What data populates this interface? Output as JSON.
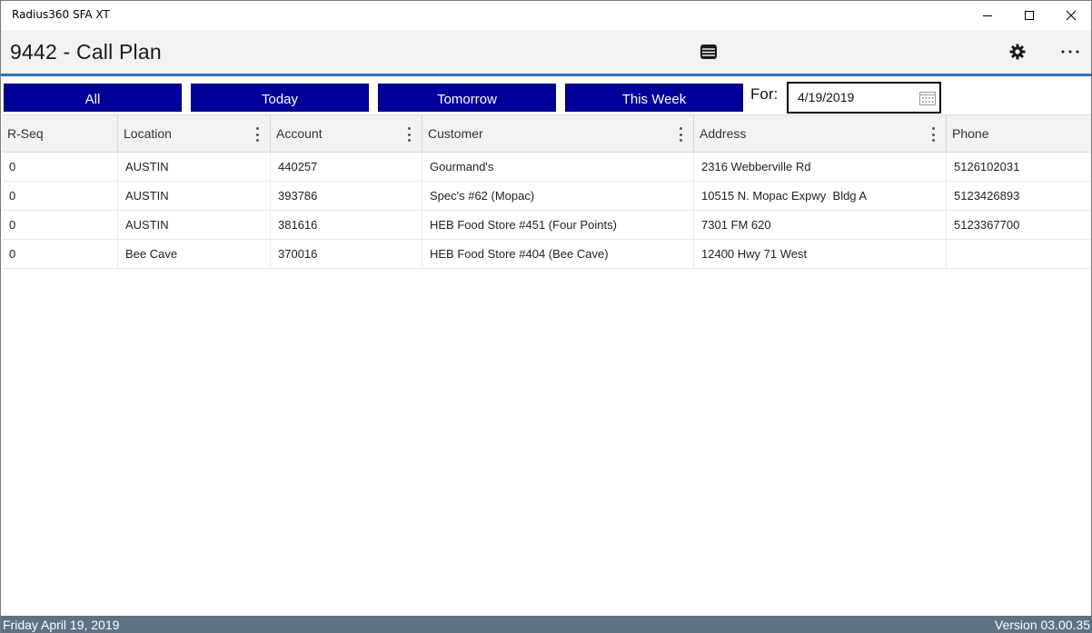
{
  "window": {
    "app_title": "Radius360 SFA XT"
  },
  "header": {
    "title": "9442 - Call Plan"
  },
  "filters": {
    "all_label": "All",
    "today_label": "Today",
    "tomorrow_label": "Tomorrow",
    "this_week_label": "This Week",
    "for_label": "For:",
    "date_value": "4/19/2019"
  },
  "grid": {
    "columns": [
      "R-Seq",
      "Location",
      "Account",
      "Customer",
      "Address",
      "Phone"
    ],
    "rows": [
      {
        "rseq": "0",
        "location": "AUSTIN",
        "account": "440257",
        "customer": "Gourmand's",
        "address": "2316 Webberville Rd",
        "phone": "5126102031"
      },
      {
        "rseq": "0",
        "location": "AUSTIN",
        "account": "393786",
        "customer": "Spec's #62 (Mopac)",
        "address": "10515 N. Mopac Expwy  Bldg A",
        "phone": "5123426893"
      },
      {
        "rseq": "0",
        "location": "AUSTIN",
        "account": "381616",
        "customer": "HEB Food Store #451 (Four Points)",
        "address": "7301 FM 620",
        "phone": "5123367700"
      },
      {
        "rseq": "0",
        "location": "Bee Cave",
        "account": "370016",
        "customer": "HEB Food Store #404 (Bee Cave)",
        "address": "12400 Hwy 71 West",
        "phone": ""
      }
    ]
  },
  "status": {
    "date_text": "Friday April 19, 2019",
    "version_text": "Version 03.00.35"
  },
  "colors": {
    "filter_button_bg": "#000099",
    "accent_line": "#2d6fb8",
    "status_bar_bg": "#5d7385"
  }
}
